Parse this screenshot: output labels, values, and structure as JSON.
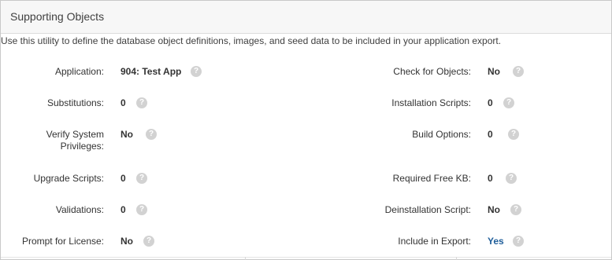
{
  "panel": {
    "title": "Supporting Objects",
    "description": "Use this utility to define the database object definitions, images, and seed data to be included in your application export."
  },
  "left_fields": [
    {
      "label": "Application:",
      "value": "904: Test App"
    },
    {
      "label": "Substitutions:",
      "value": "0"
    },
    {
      "label": "Verify System Privileges:",
      "value": "No"
    },
    {
      "label": "Upgrade Scripts:",
      "value": "0"
    },
    {
      "label": "Validations:",
      "value": "0"
    },
    {
      "label": "Prompt for License:",
      "value": "No"
    }
  ],
  "right_fields": [
    {
      "label": "Check for Objects:",
      "value": "No"
    },
    {
      "label": "Installation Scripts:",
      "value": "0"
    },
    {
      "label": "Build Options:",
      "value": "0"
    },
    {
      "label": "Required Free KB:",
      "value": "0"
    },
    {
      "label": "Deinstallation Script:",
      "value": "No"
    },
    {
      "label": "Include in Export:",
      "value": "Yes"
    }
  ],
  "help_glyph": "?",
  "icons": {
    "help": "help-icon"
  },
  "colors": {
    "link_value": "#1f5e9a",
    "help_icon": "#d2d2d2",
    "header_bg": "#f7f7f7"
  }
}
